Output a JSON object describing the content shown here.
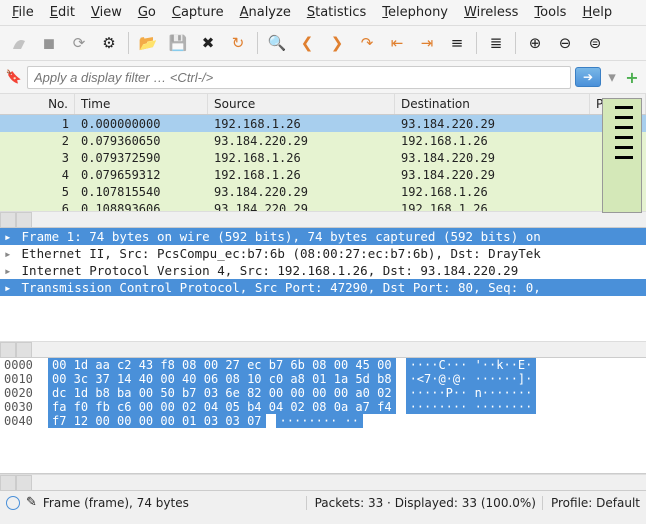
{
  "menu": [
    "File",
    "Edit",
    "View",
    "Go",
    "Capture",
    "Analyze",
    "Statistics",
    "Telephony",
    "Wireless",
    "Tools",
    "Help"
  ],
  "filter": {
    "placeholder": "Apply a display filter … <Ctrl-/>"
  },
  "columns": {
    "no": "No.",
    "time": "Time",
    "src": "Source",
    "dst": "Destination",
    "prt": "P"
  },
  "packets": [
    {
      "no": "1",
      "time": "0.000000000",
      "src": "192.168.1.26",
      "dst": "93.184.220.29",
      "sel": true,
      "cls": ""
    },
    {
      "no": "2",
      "time": "0.079360650",
      "src": "93.184.220.29",
      "dst": "192.168.1.26",
      "sel": false,
      "cls": "tcp"
    },
    {
      "no": "3",
      "time": "0.079372590",
      "src": "192.168.1.26",
      "dst": "93.184.220.29",
      "sel": false,
      "cls": "tcp"
    },
    {
      "no": "4",
      "time": "0.079659312",
      "src": "192.168.1.26",
      "dst": "93.184.220.29",
      "sel": false,
      "cls": "tcp"
    },
    {
      "no": "5",
      "time": "0.107815540",
      "src": "93.184.220.29",
      "dst": "192.168.1.26",
      "sel": false,
      "cls": "tcp"
    },
    {
      "no": "6",
      "time": "0.108893606",
      "src": "93.184.220.29",
      "dst": "192.168.1.26",
      "sel": false,
      "cls": "tcp"
    }
  ],
  "details": [
    {
      "txt": "Frame 1: 74 bytes on wire (592 bits), 74 bytes captured (592 bits) on",
      "hl": true,
      "tri": "▸"
    },
    {
      "txt": "Ethernet II, Src: PcsCompu_ec:b7:6b (08:00:27:ec:b7:6b), Dst: DrayTek",
      "hl": false,
      "tri": "▸"
    },
    {
      "txt": "Internet Protocol Version 4, Src: 192.168.1.26, Dst: 93.184.220.29",
      "hl": false,
      "tri": "▸"
    },
    {
      "txt": "Transmission Control Protocol, Src Port: 47290, Dst Port: 80, Seq: 0,",
      "hl": true,
      "tri": "▸"
    }
  ],
  "hex": [
    {
      "off": "0000",
      "h": "00 1d aa c2 43 f8 08 00  27 ec b7 6b 08 00 45 00",
      "a": "····C···  '··k··E·"
    },
    {
      "off": "0010",
      "h": "00 3c 37 14 40 00 40 06  08 10 c0 a8 01 1a 5d b8",
      "a": "·<7·@·@·  ······]·"
    },
    {
      "off": "0020",
      "h": "dc 1d b8 ba 00 50 b7 03  6e 82 00 00 00 00 a0 02",
      "a": "·····P··  n·······"
    },
    {
      "off": "0030",
      "h": "fa f0 fb c6 00 00 02 04  05 b4 04 02 08 0a a7 f4",
      "a": "········  ········"
    },
    {
      "off": "0040",
      "h": "f7 12 00 00 00 00 01 03  03 07",
      "a": "········  ··"
    }
  ],
  "status": {
    "left": "Frame (frame), 74 bytes",
    "mid": "Packets: 33 · Displayed: 33 (100.0%)",
    "right": "Profile: Default"
  }
}
